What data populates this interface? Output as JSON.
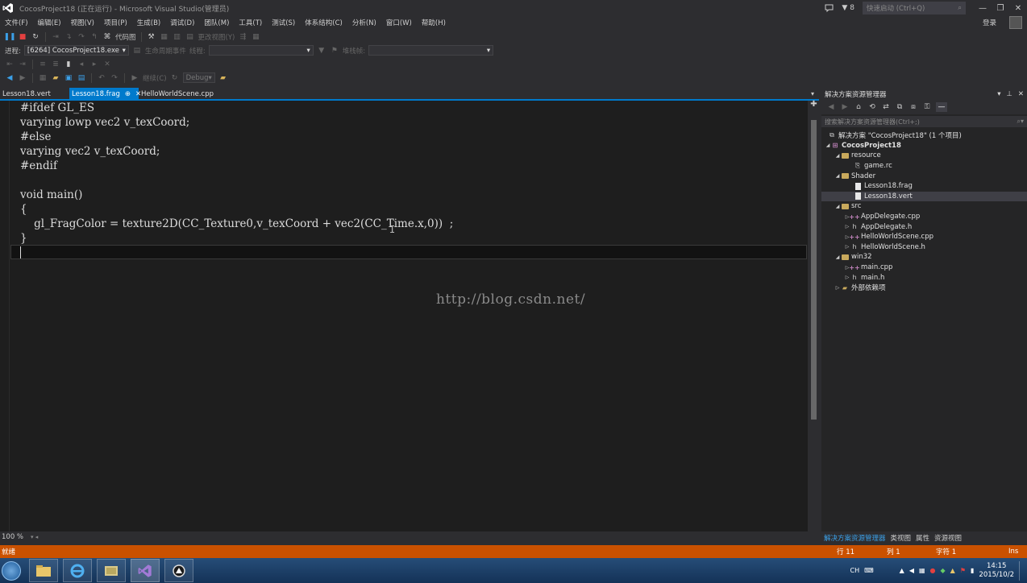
{
  "window": {
    "title": "CocosProject18 (正在运行) - Microsoft Visual Studio(管理员)",
    "notification_count": "8",
    "quick_launch_placeholder": "快速启动 (Ctrl+Q)",
    "login_label": "登录"
  },
  "menu": [
    "文件(F)",
    "编辑(E)",
    "视图(V)",
    "项目(P)",
    "生成(B)",
    "调试(D)",
    "团队(M)",
    "工具(T)",
    "测试(S)",
    "体系结构(C)",
    "分析(N)",
    "窗口(W)",
    "帮助(H)"
  ],
  "toolbar": {
    "code_map_label": "代码图",
    "change_view_label": "更改视图(Y)",
    "process_label": "进程:",
    "process_value": "[6264] CocosProject18.exe",
    "lifecycle_label": "生命周期事件",
    "thread_label": "线程:",
    "stack_label": "堆栈帧:",
    "continue_label": "继续(C)",
    "config_value": "Debug"
  },
  "tabs": [
    {
      "label": "Lesson18.vert",
      "active": false
    },
    {
      "label": "Lesson18.frag",
      "active": true,
      "pin": "⊕",
      "close": "✕"
    },
    {
      "label": "HelloWorldScene.cpp",
      "active": false
    }
  ],
  "editor": {
    "lines": [
      "#ifdef GL_ES",
      "varying lowp vec2 v_texCoord;",
      "#else",
      "varying vec2 v_texCoord;",
      "#endif",
      "",
      "void main()",
      "{",
      "    gl_FragColor = texture2D(CC_Texture0,v_texCoord + vec2(CC_Time.x,0))  ;",
      "}",
      ""
    ],
    "watermark": "http://blog.csdn.net/",
    "zoom": "100 %"
  },
  "solution_explorer": {
    "title": "解决方案资源管理器",
    "search_placeholder": "搜索解决方案资源管理器(Ctrl+;)",
    "items": [
      {
        "label": "解决方案 \"CocosProject18\" (1 个项目)",
        "type": "solution",
        "level": 0,
        "expanded": null
      },
      {
        "label": "CocosProject18",
        "type": "project",
        "level": 0,
        "expanded": true
      },
      {
        "label": "resource",
        "type": "folder",
        "level": 1,
        "expanded": true
      },
      {
        "label": "game.rc",
        "type": "file",
        "level": 2,
        "expanded": null
      },
      {
        "label": "Shader",
        "type": "folder",
        "level": 1,
        "expanded": true
      },
      {
        "label": "Lesson18.frag",
        "type": "file",
        "level": 2,
        "expanded": null
      },
      {
        "label": "Lesson18.vert",
        "type": "file",
        "level": 2,
        "expanded": null,
        "selected": true
      },
      {
        "label": "src",
        "type": "folder",
        "level": 1,
        "expanded": true
      },
      {
        "label": "AppDelegate.cpp",
        "type": "cpp",
        "level": 2,
        "expanded": false
      },
      {
        "label": "AppDelegate.h",
        "type": "h",
        "level": 2,
        "expanded": false
      },
      {
        "label": "HelloWorldScene.cpp",
        "type": "cpp",
        "level": 2,
        "expanded": false
      },
      {
        "label": "HelloWorldScene.h",
        "type": "h",
        "level": 2,
        "expanded": false
      },
      {
        "label": "win32",
        "type": "folder",
        "level": 1,
        "expanded": true
      },
      {
        "label": "main.cpp",
        "type": "cpp",
        "level": 2,
        "expanded": false
      },
      {
        "label": "main.h",
        "type": "h",
        "level": 2,
        "expanded": false
      },
      {
        "label": "外部依赖项",
        "type": "deps",
        "level": 1,
        "expanded": false
      }
    ],
    "bottom_tabs": [
      "解决方案资源管理器",
      "类视图",
      "属性",
      "资源视图"
    ]
  },
  "status": {
    "ready": "就绪",
    "line": "行 11",
    "col": "列 1",
    "char": "字符 1",
    "mode": "Ins",
    "color": "#ca5100"
  },
  "taskbar": {
    "lang": "CH",
    "time": "14:15",
    "date": "2015/10/2"
  }
}
